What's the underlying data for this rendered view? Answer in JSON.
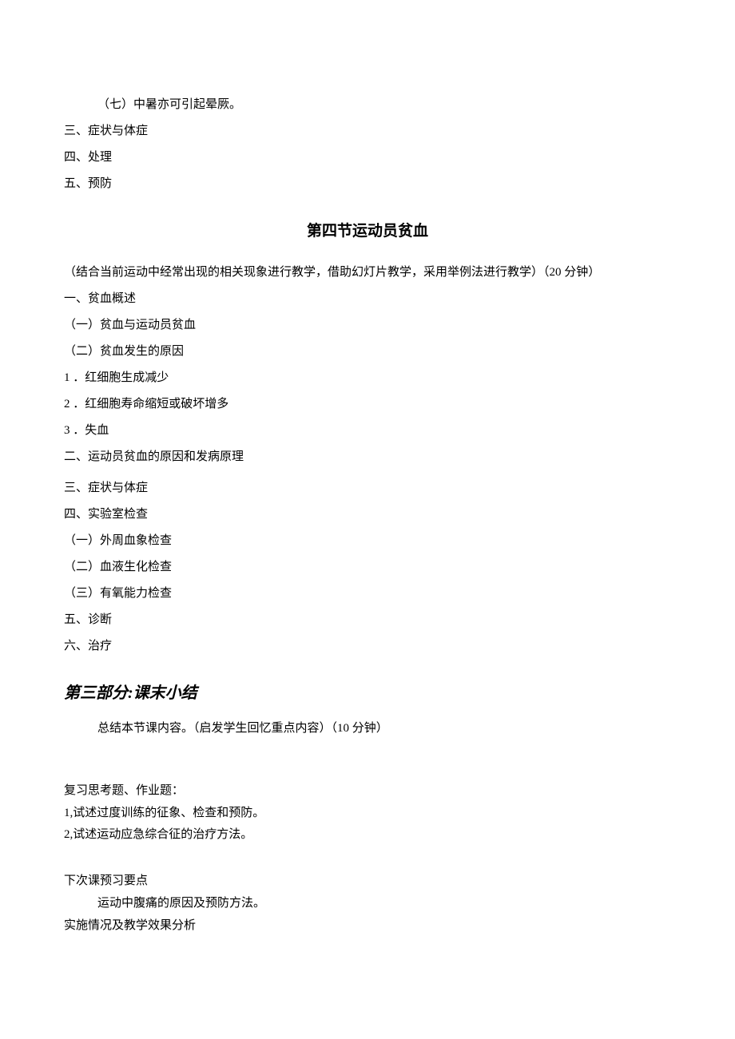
{
  "top": {
    "item7": "（七）中暑亦可引起晕厥。",
    "san": "三、症状与体症",
    "si": "四、处理",
    "wu": "五、预防"
  },
  "section4": {
    "title": "第四节运动员贫血",
    "note": "（结合当前运动中经常出现的相关现象进行教学，借助幻灯片教学，采用举例法进行教学）（20 分钟）",
    "yi": "一、贫血概述",
    "yi1": "（一）贫血与运动员贫血",
    "yi2": "（二）贫血发生的原因",
    "l1": "1 ．红细胞生成减少",
    "l2": "2 ．红细胞寿命缩短或破坏增多",
    "l3": "3 ．失血",
    "er": "二、运动员贫血的原因和发病原理",
    "san": "三、症状与体症",
    "si": "四、实验室检查",
    "si1": "（一）外周血象检查",
    "si2": "（二）血液生化检查",
    "si3": "（三）有氧能力检查",
    "wu": "五、诊断",
    "liu": "六、治疗"
  },
  "part3": {
    "heading": "第三部分:课末小结",
    "summary": "总结本节课内容。（启发学生回忆重点内容）（10 分钟）"
  },
  "review": {
    "title": "复习思考题、作业题：",
    "q1": "1,试述过度训练的征象、检查和预防。",
    "q2": "2,试述运动应急综合征的治疗方法。"
  },
  "next": {
    "title": "下次课预习要点",
    "content": "运动中腹痛的原因及预防方法。",
    "impl": "实施情况及教学效果分析"
  }
}
